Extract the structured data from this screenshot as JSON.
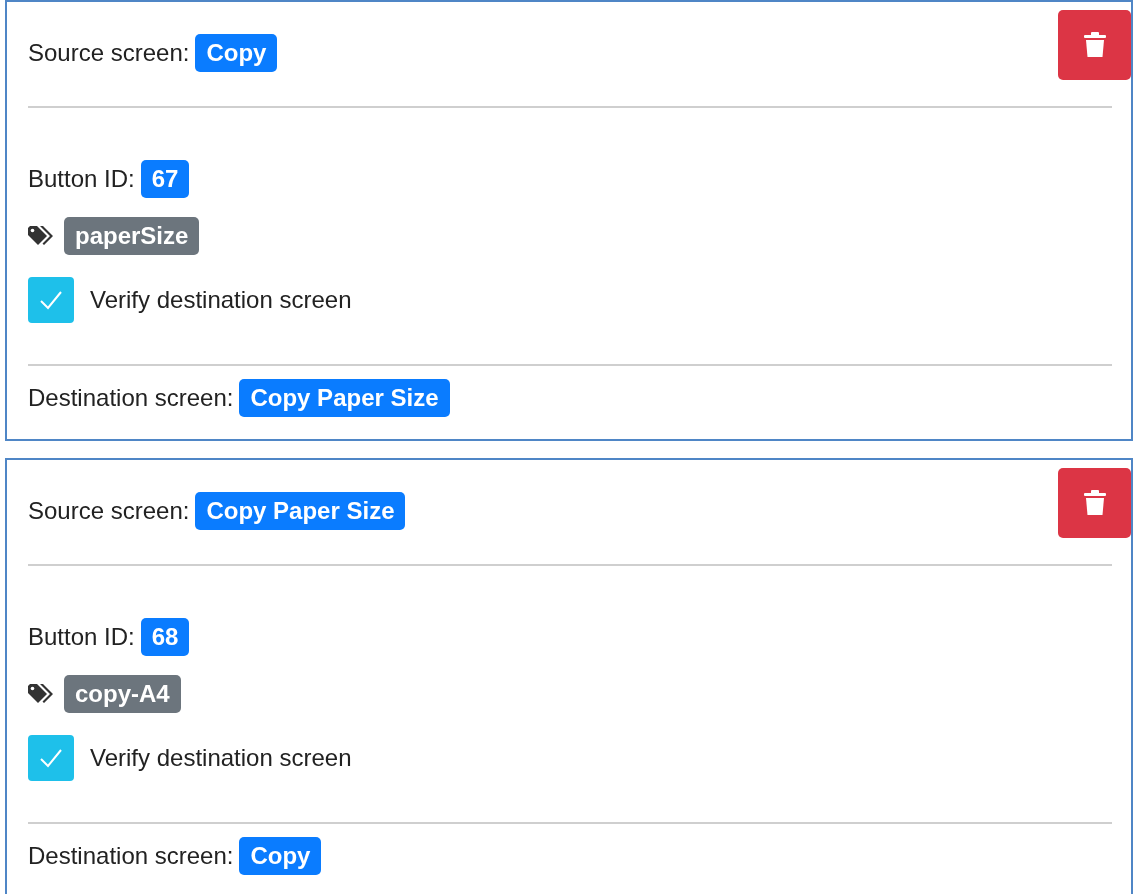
{
  "cards": [
    {
      "source_label": "Source screen:",
      "source_screen": "Copy",
      "button_id_label": "Button ID:",
      "button_id": "67",
      "tag": "paperSize",
      "verify": {
        "label": "Verify destination screen",
        "checked": true
      },
      "destination_label": "Destination screen:",
      "destination_screen": "Copy Paper Size"
    },
    {
      "source_label": "Source screen:",
      "source_screen": "Copy Paper Size",
      "button_id_label": "Button ID:",
      "button_id": "68",
      "tag": "copy-A4",
      "verify": {
        "label": "Verify destination screen",
        "checked": true
      },
      "destination_label": "Destination screen:",
      "destination_screen": "Copy"
    }
  ]
}
